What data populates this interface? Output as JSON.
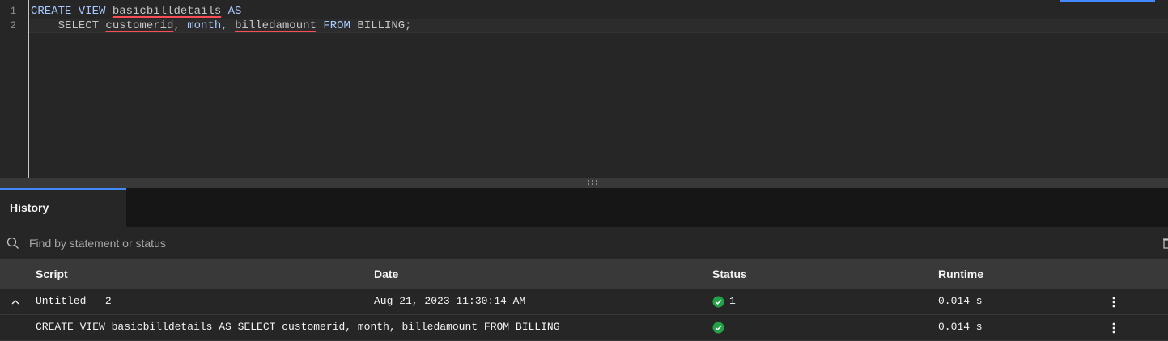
{
  "editor": {
    "line_numbers": [
      "1",
      "2"
    ],
    "lines": [
      [
        {
          "text": "CREATE VIEW ",
          "kind": "kw"
        },
        {
          "text": "basicbilldetails",
          "kind": "err"
        },
        {
          "text": " ",
          "kind": "plain"
        },
        {
          "text": "AS",
          "kind": "kw"
        }
      ],
      [
        {
          "text": "    SELECT ",
          "kind": "plain"
        },
        {
          "text": "customerid",
          "kind": "err"
        },
        {
          "text": ", ",
          "kind": "plain"
        },
        {
          "text": "month",
          "kind": "kw"
        },
        {
          "text": ", ",
          "kind": "plain"
        },
        {
          "text": "billedamount",
          "kind": "err"
        },
        {
          "text": " ",
          "kind": "plain"
        },
        {
          "text": "FROM",
          "kind": "kw"
        },
        {
          "text": " BILLING;",
          "kind": "plain"
        }
      ]
    ]
  },
  "history": {
    "tab_label": "History",
    "search_placeholder": "Find by statement or status",
    "columns": {
      "script": "Script",
      "date": "Date",
      "status": "Status",
      "runtime": "Runtime"
    },
    "rows": [
      {
        "script": "Untitled - 2",
        "date": "Aug 21, 2023 11:30:14 AM",
        "status_count": "1",
        "runtime": "0.014 s",
        "expanded": true
      },
      {
        "script": "CREATE VIEW basicbilldetails AS SELECT customerid, month, billedamount FROM BILLING",
        "date": "",
        "status_count": "",
        "runtime": "0.014 s"
      }
    ]
  },
  "colors": {
    "accent": "#4589ff",
    "success": "#24a148",
    "error_underline": "#fa4d56",
    "keyword": "#a6c8ff"
  },
  "icons": {
    "search": "search-icon",
    "trash": "trash-icon",
    "chevron": "chevron-up-icon",
    "status": "checkmark-filled-icon",
    "overflow": "overflow-menu-vertical-icon"
  }
}
